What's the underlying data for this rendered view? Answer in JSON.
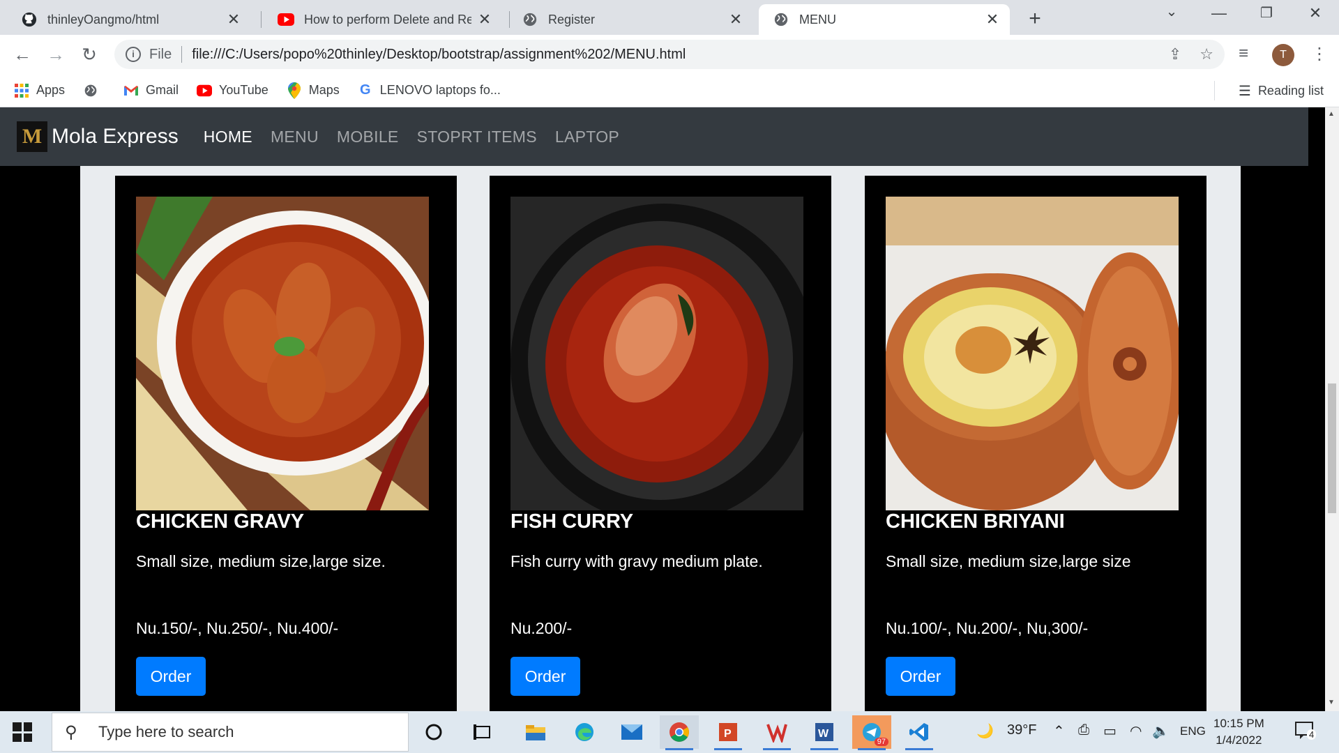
{
  "browser": {
    "tabs": [
      {
        "title": "thinleyOangmo/html",
        "icon": "github-icon",
        "active": false
      },
      {
        "title": "How to perform Delete and Rem",
        "icon": "youtube-icon",
        "active": false
      },
      {
        "title": "Register",
        "icon": "globe-icon",
        "active": false
      },
      {
        "title": "MENU",
        "icon": "globe-icon",
        "active": true
      }
    ],
    "address": {
      "scheme": "File",
      "url": "file:///C:/Users/popo%20thinley/Desktop/bootstrap/assignment%202/MENU.html"
    },
    "profile_initial": "T",
    "bookmarks": [
      {
        "label": "Apps",
        "icon": "apps-grid-icon"
      },
      {
        "label": "",
        "icon": "globe-icon"
      },
      {
        "label": "Gmail",
        "icon": "gmail-icon"
      },
      {
        "label": "YouTube",
        "icon": "youtube-icon"
      },
      {
        "label": "Maps",
        "icon": "maps-pin-icon"
      },
      {
        "label": "LENOVO laptops fo...",
        "icon": "google-icon"
      }
    ],
    "reading_list": "Reading list"
  },
  "site": {
    "brand_logo_letter": "M",
    "brand": "Mola Express",
    "nav": [
      {
        "label": "HOME",
        "active": true
      },
      {
        "label": "MENU",
        "active": false
      },
      {
        "label": "MOBILE",
        "active": false
      },
      {
        "label": "STOPRT ITEMS",
        "active": false
      },
      {
        "label": "LAPTOP",
        "active": false
      }
    ],
    "cards": [
      {
        "title": "CHICKEN GRAVY",
        "description": "Small size, medium size,large size.",
        "price": "Nu.150/-, Nu.250/-, Nu.400/-",
        "button": "Order",
        "image": "chicken-gravy-photo"
      },
      {
        "title": "FISH CURRY",
        "description": "Fish curry with gravy medium plate.",
        "price": "Nu.200/-",
        "button": "Order",
        "image": "fish-curry-photo"
      },
      {
        "title": "CHICKEN BRIYANI",
        "description": "Small size, medium size,large size",
        "price": "Nu.100/-, Nu.200/-, Nu,300/-",
        "button": "Order",
        "image": "chicken-briyani-photo"
      }
    ],
    "colors": {
      "navbar": "#343a40",
      "button": "#007bff",
      "card": "#000000",
      "container": "#e9ecef"
    }
  },
  "taskbar": {
    "search_placeholder": "Type here to search",
    "weather": "39°F",
    "language": "ENG",
    "time": "10:15 PM",
    "date": "1/4/2022",
    "notification_count": "4",
    "telegram_badge": "97"
  }
}
